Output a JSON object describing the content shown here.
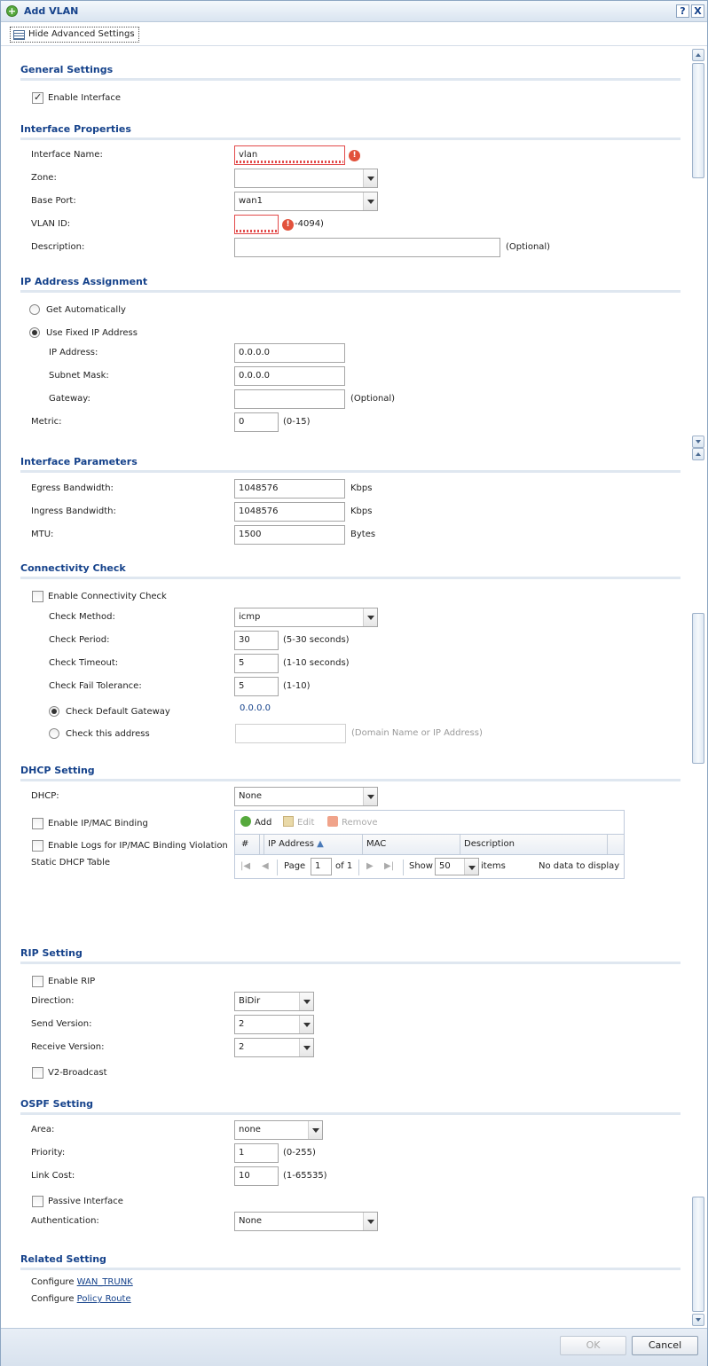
{
  "title": "Add VLAN",
  "title_buttons": {
    "help": "?",
    "close": "X"
  },
  "advanced_label": "Hide Advanced Settings",
  "general": {
    "title": "General Settings",
    "enable_interface": "Enable Interface"
  },
  "iface_props": {
    "title": "Interface Properties",
    "name_label": "Interface Name:",
    "name_value": "vlan",
    "zone_label": "Zone:",
    "zone_value": "",
    "base_port_label": "Base Port:",
    "base_port_value": "wan1",
    "vlan_id_label": "VLAN ID:",
    "vlan_id_hint": "-4094)",
    "desc_label": "Description:",
    "optional": "(Optional)"
  },
  "ip_assign": {
    "title": "IP Address Assignment",
    "get_auto": "Get Automatically",
    "use_fixed": "Use Fixed IP Address",
    "ip_label": "IP Address:",
    "ip_value": "0.0.0.0",
    "mask_label": "Subnet Mask:",
    "mask_value": "0.0.0.0",
    "gw_label": "Gateway:",
    "optional": "(Optional)",
    "metric_label": "Metric:",
    "metric_value": "0",
    "metric_hint": "(0-15)"
  },
  "params": {
    "title": "Interface Parameters",
    "egress_label": "Egress Bandwidth:",
    "egress_value": "1048576",
    "egress_unit": "Kbps",
    "ingress_label": "Ingress Bandwidth:",
    "ingress_value": "1048576",
    "ingress_unit": "Kbps",
    "mtu_label": "MTU:",
    "mtu_value": "1500",
    "mtu_unit": "Bytes"
  },
  "conn": {
    "title": "Connectivity Check",
    "enable": "Enable Connectivity Check",
    "method_label": "Check Method:",
    "method_value": "icmp",
    "period_label": "Check Period:",
    "period_value": "30",
    "period_hint": "(5-30 seconds)",
    "timeout_label": "Check Timeout:",
    "timeout_value": "5",
    "timeout_hint": "(1-10 seconds)",
    "fail_label": "Check Fail Tolerance:",
    "fail_value": "5",
    "fail_hint": "(1-10)",
    "default_gw": "Check Default Gateway",
    "default_gw_value": "0.0.0.0",
    "this_addr": "Check this address",
    "this_addr_hint": "(Domain Name or IP Address)"
  },
  "dhcp": {
    "title": "DHCP Setting",
    "dhcp_label": "DHCP:",
    "dhcp_value": "None",
    "ipmac": "Enable IP/MAC Binding",
    "ipmac_logs": "Enable Logs for IP/MAC Binding Violation",
    "static_table": "Static DHCP Table",
    "grid": {
      "add": "Add",
      "edit": "Edit",
      "remove": "Remove",
      "columns": [
        "#",
        "IP Address",
        "MAC",
        "Description"
      ],
      "page_label": "Page",
      "page_value": "1",
      "of_label": "of 1",
      "show_label": "Show",
      "show_value": "50",
      "items_label": "items",
      "empty": "No data to display"
    }
  },
  "rip": {
    "title": "RIP Setting",
    "enable": "Enable RIP",
    "direction_label": "Direction:",
    "direction_value": "BiDir",
    "send_label": "Send Version:",
    "send_value": "2",
    "recv_label": "Receive Version:",
    "recv_value": "2",
    "v2": "V2-Broadcast"
  },
  "ospf": {
    "title": "OSPF Setting",
    "area_label": "Area:",
    "area_value": "none",
    "priority_label": "Priority:",
    "priority_value": "1",
    "priority_hint": "(0-255)",
    "cost_label": "Link Cost:",
    "cost_value": "10",
    "cost_hint": "(1-65535)",
    "passive": "Passive Interface",
    "auth_label": "Authentication:",
    "auth_value": "None"
  },
  "related": {
    "title": "Related Setting",
    "configure": "Configure",
    "wan_trunk": "WAN_TRUNK",
    "policy_route": "Policy Route"
  },
  "footer": {
    "ok": "OK",
    "cancel": "Cancel"
  }
}
